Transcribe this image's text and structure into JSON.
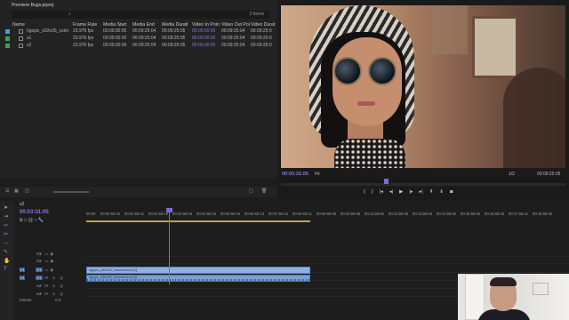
{
  "project": {
    "title": "Premiere Bugs.prproj",
    "search_icon": "search-icon",
    "item_count": "3 Items",
    "columns": [
      "Name",
      "Frame Rate",
      "Media Start",
      "Media End",
      "Media Durati",
      "Video In Poin",
      "Video Out Poi",
      "Video Durat"
    ],
    "rows": [
      {
        "name": "hgspic_s02e05_color",
        "color": "#3fa0d8",
        "frame_rate": "23.976 fps",
        "media_start": "00:00:00:00",
        "media_end": "00:09:25:04",
        "media_duration": "00:09:25:05",
        "video_in": "00:00:00:00",
        "video_out": "00:09:25:04",
        "video_duration": "00:09:25:0"
      },
      {
        "name": "s1",
        "color": "#3aa35a",
        "frame_rate": "23.976 fps",
        "media_start": "00:00:00:00",
        "media_end": "00:09:25:04",
        "media_duration": "00:09:25:05",
        "video_in": "00:00:00:00",
        "video_out": "00:09:25:04",
        "video_duration": "00:09:25:0"
      },
      {
        "name": "s2",
        "color": "#3aa35a",
        "frame_rate": "23.976 fps",
        "media_start": "00:00:00:00",
        "media_end": "00:09:25:04",
        "media_duration": "00:09:25:05",
        "video_in": "00:00:00:00",
        "video_out": "00:09:25:04",
        "video_duration": "00:09:25:0"
      }
    ]
  },
  "monitor": {
    "current_timecode": "00:03:31:05",
    "fit": "Fit",
    "resolution": "1/2",
    "duration": "00:09:25:05",
    "transport": [
      "mark-in-icon",
      "mark-out-icon",
      "go-to-in-icon",
      "step-back-icon",
      "play-icon",
      "step-forward-icon",
      "go-to-out-icon",
      "lift-icon",
      "extract-icon",
      "export-frame-icon"
    ],
    "transport_glyphs": [
      "{",
      "}",
      "|◂",
      "◂|",
      "▶",
      "|▸",
      "▸|",
      "⇞",
      "⇟",
      "◙"
    ]
  },
  "timeline": {
    "tab": "s2",
    "timecode": "00:03:31:05",
    "ruler_labels": [
      "00:00",
      "00:00:59:22",
      "00:01:59:21",
      "00:02:59:19",
      "00:03:59:18",
      "00:04:59:16",
      "00:05:59:15",
      "00:06:59:13",
      "00:07:59:12",
      "00:08:59:11",
      "00:09:59:09",
      "00:10:59:08",
      "00:11:59:06",
      "00:12:59:05",
      "00:13:59:03",
      "00:14:59:02",
      "00:15:59:00",
      "00:16:58:23",
      "00:17:58:21",
      "00:18:58:20"
    ],
    "tracks": [
      {
        "name": "V3",
        "type": "video",
        "active": false
      },
      {
        "name": "V2",
        "type": "video",
        "active": false
      },
      {
        "name": "V1",
        "type": "video",
        "active": true
      },
      {
        "name": "A1",
        "type": "audio",
        "active": true
      },
      {
        "name": "A2",
        "type": "audio",
        "active": false
      },
      {
        "name": "A3",
        "type": "audio",
        "active": false
      }
    ],
    "video_clip_label": "hgspic_s02e05_colored.mov [V]",
    "audio_clip_label": "hgspic_s02e05_colored.mov [A]",
    "master_label": "Master",
    "master_value": "0.0",
    "accent_color": "#7a6cd6",
    "clip_color": "#8db0e6"
  }
}
